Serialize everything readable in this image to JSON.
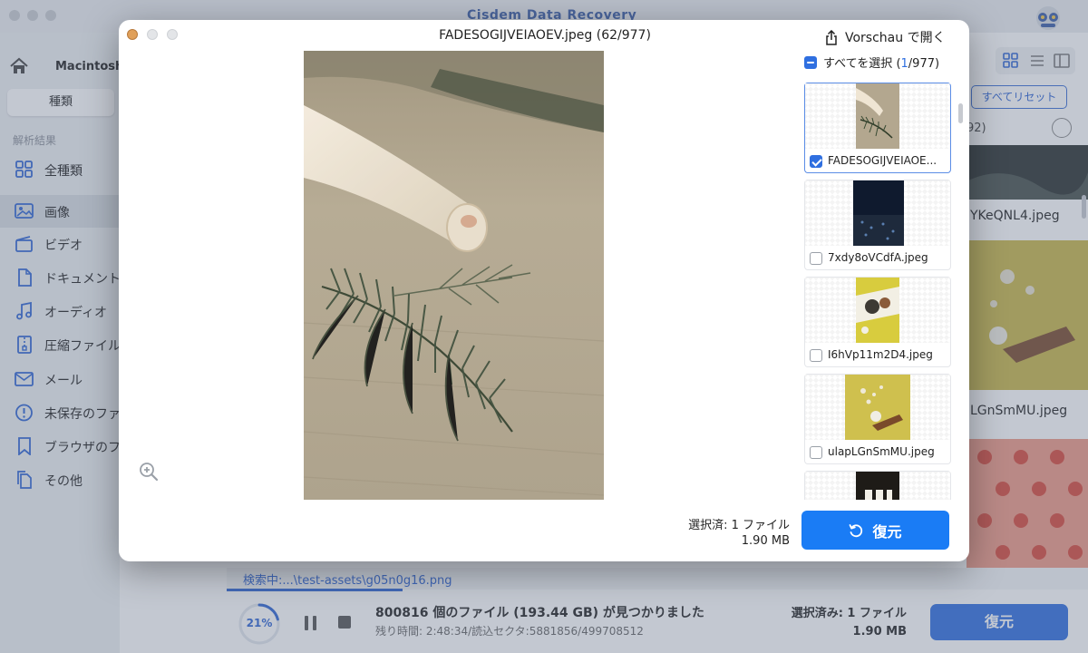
{
  "app": {
    "title": "Cisdem Data Recovery",
    "drive_name": "Macintosh",
    "tab_kind": "種類",
    "section_label": "解析結果",
    "categories": [
      {
        "label": "全種類",
        "icon": "grid-icon"
      },
      {
        "label": "画像",
        "icon": "image-icon"
      },
      {
        "label": "ビデオ",
        "icon": "video-icon"
      },
      {
        "label": "ドキュメント",
        "icon": "document-icon"
      },
      {
        "label": "オーディオ",
        "icon": "music-icon"
      },
      {
        "label": "圧縮ファイル",
        "icon": "zip-icon"
      },
      {
        "label": "メール",
        "icon": "mail-icon"
      },
      {
        "label": "未保存のファ",
        "icon": "alert-icon"
      },
      {
        "label": "ブラウザのフ",
        "icon": "bookmark-icon"
      },
      {
        "label": "その他",
        "icon": "files-icon"
      }
    ],
    "reset_label": "すべてリセット",
    "count_text": "92)",
    "bg_names": [
      "YKeQNL4.jpeg",
      "LGnSmMU.jpeg"
    ],
    "path_text": "検索中:...\\test-assets\\g05n0g16.png",
    "progress_label": "21%",
    "progress_value": 0.21,
    "found_text": "800816 個のファイル (193.44 GB) が見つかりました",
    "remaining_text": "残り時間: 2:48:34/読込セクタ:5881856/499708512",
    "bottom_selected": "選択済み: 1 ファイル",
    "bottom_size": "1.90 MB",
    "bottom_recover": "復元"
  },
  "modal": {
    "title": "FADESOGIJVEIAOEV.jpeg (62/977)",
    "open_in_preview": "Vorschau で開く",
    "select_all_prefix": "すべてを選択 (",
    "select_all_count": "1",
    "select_all_suffix": "/977)",
    "thumbnails": [
      {
        "name": "FADESOGIJVEIAOEV.jpeg",
        "display": "FADESOGIJVEIAOE...",
        "checked": true
      },
      {
        "name": "7xdy8oVCdfA.jpeg",
        "display": "7xdy8oVCdfA.jpeg",
        "checked": false
      },
      {
        "name": "I6hVp11m2D4.jpeg",
        "display": "I6hVp11m2D4.jpeg",
        "checked": false
      },
      {
        "name": "ulapLGnSmMU.jpeg",
        "display": "ulapLGnSmMU.jpeg",
        "checked": false
      }
    ],
    "selected_label": "選択済: 1 ファイル",
    "selected_size": "1.90 MB",
    "recover_label": "復元"
  },
  "colors": {
    "accent": "#1a7cf5",
    "link": "#2e64d4"
  }
}
